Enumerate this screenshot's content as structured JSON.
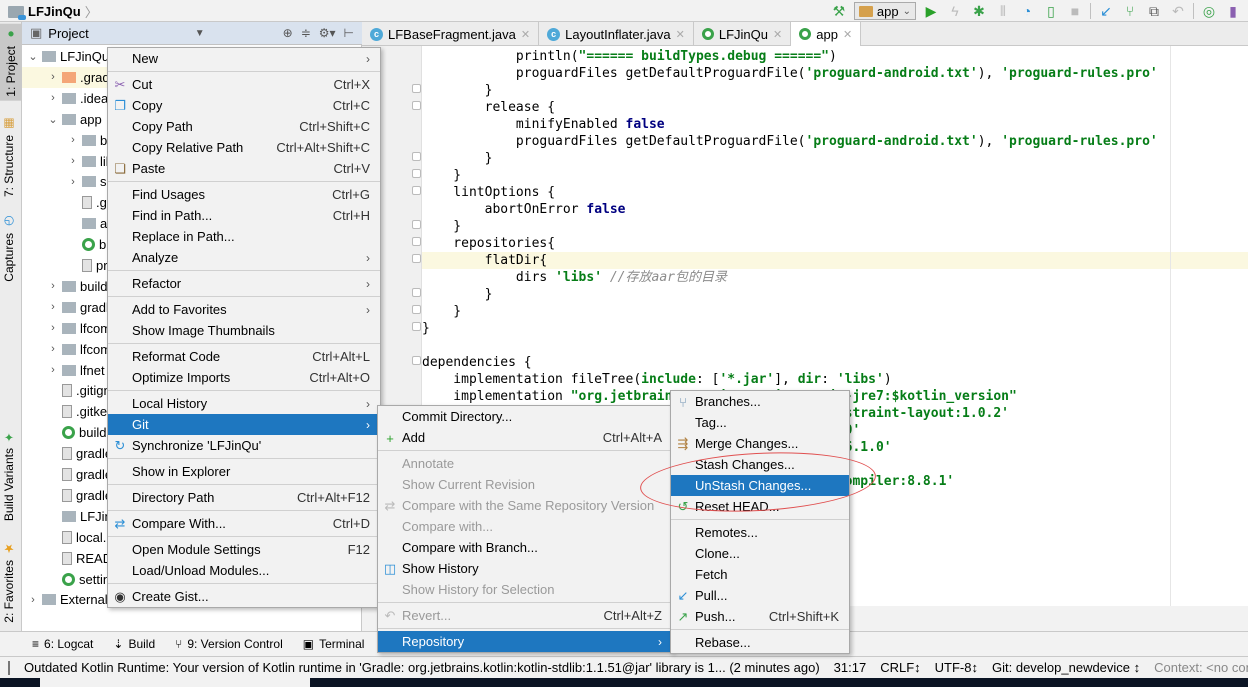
{
  "navbar": {
    "project_name": "LFJinQu",
    "run_config": "app"
  },
  "left_strip": {
    "tabs": [
      {
        "label": "1: Project",
        "active": true
      },
      {
        "label": "7: Structure"
      },
      {
        "label": "Captures"
      },
      {
        "label": "Build Variants"
      },
      {
        "label": "2: Favorites"
      }
    ]
  },
  "project_panel": {
    "title": "Project",
    "tree": [
      {
        "label": "LFJinQu",
        "indent": 0,
        "expanded": true,
        "icon": "module-folder"
      },
      {
        "label": ".gradle",
        "indent": 1,
        "collapsed": true,
        "icon": "orange-folder",
        "highlight": true
      },
      {
        "label": ".idea",
        "indent": 1,
        "collapsed": true,
        "icon": "folder"
      },
      {
        "label": "app",
        "indent": 1,
        "expanded": true,
        "icon": "module-folder"
      },
      {
        "label": "build",
        "indent": 2,
        "collapsed": true,
        "icon": "folder"
      },
      {
        "label": "libs",
        "indent": 2,
        "collapsed": true,
        "icon": "folder"
      },
      {
        "label": "src",
        "indent": 2,
        "collapsed": true,
        "icon": "folder"
      },
      {
        "label": ".gitignore",
        "indent": 2,
        "icon": "file"
      },
      {
        "label": "app.iml",
        "indent": 2,
        "icon": "module-file"
      },
      {
        "label": "build.gradle",
        "indent": 2,
        "icon": "gradle"
      },
      {
        "label": "proguard-rules.pro",
        "indent": 2,
        "icon": "file"
      },
      {
        "label": "build",
        "indent": 1,
        "collapsed": true,
        "icon": "folder"
      },
      {
        "label": "gradle",
        "indent": 1,
        "collapsed": true,
        "icon": "folder"
      },
      {
        "label": "lfcommon",
        "indent": 1,
        "collapsed": true,
        "icon": "lib-folder"
      },
      {
        "label": "lfcomponent",
        "indent": 1,
        "collapsed": true,
        "icon": "lib-folder"
      },
      {
        "label": "lfnet",
        "indent": 1,
        "collapsed": true,
        "icon": "lib-folder"
      },
      {
        "label": ".gitignore",
        "indent": 1,
        "icon": "file"
      },
      {
        "label": ".gitkeep",
        "indent": 1,
        "icon": "unknown-file"
      },
      {
        "label": "build.gradle",
        "indent": 1,
        "icon": "gradle"
      },
      {
        "label": "gradle.properties",
        "indent": 1,
        "icon": "props-file"
      },
      {
        "label": "gradlew",
        "indent": 1,
        "icon": "file"
      },
      {
        "label": "gradlew.bat",
        "indent": 1,
        "icon": "file"
      },
      {
        "label": "LFJinQu.iml",
        "indent": 1,
        "icon": "module-file"
      },
      {
        "label": "local.properties",
        "indent": 1,
        "icon": "props-file"
      },
      {
        "label": "README.md",
        "indent": 1,
        "icon": "unknown-file"
      },
      {
        "label": "settings.gradle",
        "indent": 1,
        "icon": "gradle"
      },
      {
        "label": "External Libraries",
        "indent": 0,
        "collapsed": true,
        "icon": "libraries"
      }
    ]
  },
  "editor_tabs": [
    {
      "label": "LFBaseFragment.java",
      "icon": "class"
    },
    {
      "label": "LayoutInflater.java",
      "icon": "class"
    },
    {
      "label": "LFJinQu",
      "icon": "gradle"
    },
    {
      "label": "app",
      "icon": "gradle",
      "active": true
    }
  ],
  "editor": {
    "lines": [
      [
        {
          "t": "            println("
        },
        {
          "t": "\"====== buildTypes.debug ======\"",
          "c": "str"
        },
        {
          "t": ")"
        }
      ],
      [
        {
          "t": "            proguardFiles getDefaultProguardFile("
        },
        {
          "t": "'proguard-android.txt'",
          "c": "str"
        },
        {
          "t": "), "
        },
        {
          "t": "'proguard-rules.pro'",
          "c": "str"
        }
      ],
      [
        {
          "t": "        }"
        }
      ],
      [
        {
          "t": "        release {"
        }
      ],
      [
        {
          "t": "            minifyEnabled "
        },
        {
          "t": "false",
          "c": "kw"
        }
      ],
      [
        {
          "t": "            proguardFiles getDefaultProguardFile("
        },
        {
          "t": "'proguard-android.txt'",
          "c": "str"
        },
        {
          "t": "), "
        },
        {
          "t": "'proguard-rules.pro'",
          "c": "str"
        }
      ],
      [
        {
          "t": "        }"
        }
      ],
      [
        {
          "t": "    }"
        }
      ],
      [
        {
          "t": "    lintOptions {"
        }
      ],
      [
        {
          "t": "        abortOnError "
        },
        {
          "t": "false",
          "c": "kw"
        }
      ],
      [
        {
          "t": "    }"
        }
      ],
      [
        {
          "t": "    repositories{"
        }
      ],
      [
        {
          "t": "        flatDir{"
        }
      ],
      [
        {
          "t": "            dirs "
        },
        {
          "t": "'libs'",
          "c": "str"
        },
        {
          "t": " //存放aar包的目录",
          "c": "cmt"
        }
      ],
      [
        {
          "t": "        }"
        }
      ],
      [
        {
          "t": "    }"
        }
      ],
      [
        {
          "t": "}"
        }
      ],
      [
        {
          "t": ""
        }
      ],
      [
        {
          "t": "dependencies {"
        }
      ],
      [
        {
          "t": "    implementation fileTree("
        },
        {
          "t": "include",
          "c": "str"
        },
        {
          "t": ": ["
        },
        {
          "t": "'*.jar'",
          "c": "str"
        },
        {
          "t": "], "
        },
        {
          "t": "dir",
          "c": "str"
        },
        {
          "t": ": "
        },
        {
          "t": "'libs'",
          "c": "str"
        },
        {
          "t": ")"
        }
      ],
      [
        {
          "t": "    implementation "
        },
        {
          "t": "\"org.jetbrains.kotlin:kotlin-stdlib-jre7:$kotlin_version\"",
          "c": "str"
        }
      ],
      [
        {
          "t": "    implementation "
        },
        {
          "t": "'com.android.support.constraint:constraint-layout:1.0.2'",
          "c": "str"
        }
      ],
      [
        {
          "t": "    implementation "
        },
        {
          "t": "'com.jakewharton:butterknife:8.8.1.0'",
          "c": "str"
        }
      ],
      [
        {
          "t": "    implementation "
        },
        {
          "t": "'com.android.support:appcompat-v7:26.1.0'",
          "c": "str"
        }
      ],
      [
        {
          "t": ""
        }
      ],
      [
        {
          "t": "    annotationProcessor "
        },
        {
          "t": "'com.jakewharton:butterknife-compiler:8.8.1'",
          "c": "str"
        }
      ]
    ],
    "highlight_line": 12,
    "visible_tail_fragments": [
      " .1.0'",
      " .0'"
    ]
  },
  "context_menu": {
    "items": [
      {
        "label": "New",
        "submenu": true
      },
      {
        "sep": true
      },
      {
        "label": "Cut",
        "shortcut": "Ctrl+X",
        "icon": "scissors-icon"
      },
      {
        "label": "Copy",
        "shortcut": "Ctrl+C",
        "icon": "copy-icon"
      },
      {
        "label": "Copy Path",
        "shortcut": "Ctrl+Shift+C"
      },
      {
        "label": "Copy Relative Path",
        "shortcut": "Ctrl+Alt+Shift+C"
      },
      {
        "label": "Paste",
        "shortcut": "Ctrl+V",
        "icon": "paste-icon"
      },
      {
        "sep": true
      },
      {
        "label": "Find Usages",
        "shortcut": "Ctrl+G"
      },
      {
        "label": "Find in Path...",
        "shortcut": "Ctrl+H"
      },
      {
        "label": "Replace in Path..."
      },
      {
        "label": "Analyze",
        "submenu": true
      },
      {
        "sep": true
      },
      {
        "label": "Refactor",
        "submenu": true
      },
      {
        "sep": true
      },
      {
        "label": "Add to Favorites",
        "submenu": true
      },
      {
        "label": "Show Image Thumbnails"
      },
      {
        "sep": true
      },
      {
        "label": "Reformat Code",
        "shortcut": "Ctrl+Alt+L"
      },
      {
        "label": "Optimize Imports",
        "shortcut": "Ctrl+Alt+O"
      },
      {
        "sep": true
      },
      {
        "label": "Local History",
        "submenu": true
      },
      {
        "label": "Git",
        "submenu": true,
        "selected": true
      },
      {
        "label": "Synchronize 'LFJinQu'",
        "icon": "sync-icon"
      },
      {
        "sep": true
      },
      {
        "label": "Show in Explorer"
      },
      {
        "sep": true
      },
      {
        "label": "Directory Path",
        "shortcut": "Ctrl+Alt+F12"
      },
      {
        "sep": true
      },
      {
        "label": "Compare With...",
        "shortcut": "Ctrl+D",
        "icon": "compare-icon"
      },
      {
        "sep": true
      },
      {
        "label": "Open Module Settings",
        "shortcut": "F12"
      },
      {
        "label": "Load/Unload Modules..."
      },
      {
        "sep": true
      },
      {
        "label": "Create Gist...",
        "icon": "github-icon"
      }
    ]
  },
  "git_menu": {
    "items": [
      {
        "label": "Commit Directory..."
      },
      {
        "label": "Add",
        "shortcut": "Ctrl+Alt+A",
        "icon": "plus-icon"
      },
      {
        "sep": true
      },
      {
        "label": "Annotate",
        "disabled": true
      },
      {
        "label": "Show Current Revision",
        "disabled": true
      },
      {
        "label": "Compare with the Same Repository Version",
        "disabled": true,
        "icon": "compare-icon"
      },
      {
        "label": "Compare with...",
        "disabled": true
      },
      {
        "label": "Compare with Branch..."
      },
      {
        "label": "Show History",
        "icon": "history-icon"
      },
      {
        "label": "Show History for Selection",
        "disabled": true
      },
      {
        "sep": true
      },
      {
        "label": "Revert...",
        "shortcut": "Ctrl+Alt+Z",
        "disabled": true,
        "icon": "revert-icon"
      },
      {
        "sep": true
      },
      {
        "label": "Repository",
        "submenu": true,
        "selected": true
      }
    ]
  },
  "repository_menu": {
    "items": [
      {
        "label": "Branches...",
        "icon": "branch-icon"
      },
      {
        "label": "Tag..."
      },
      {
        "label": "Merge Changes...",
        "icon": "merge-icon"
      },
      {
        "label": "Stash Changes..."
      },
      {
        "label": "UnStash Changes...",
        "selected": true
      },
      {
        "label": "Reset HEAD...",
        "icon": "reset-icon"
      },
      {
        "sep": true
      },
      {
        "label": "Remotes..."
      },
      {
        "label": "Clone..."
      },
      {
        "label": "Fetch"
      },
      {
        "label": "Pull...",
        "icon": "pull-icon"
      },
      {
        "label": "Push...",
        "shortcut": "Ctrl+Shift+K",
        "icon": "push-icon"
      },
      {
        "sep": true
      },
      {
        "label": "Rebase..."
      }
    ]
  },
  "bottom_tools": [
    {
      "label": "6: Logcat",
      "icon": "logcat-icon"
    },
    {
      "label": "Build",
      "icon": "build-icon"
    },
    {
      "label": "9: Version Control",
      "icon": "vcs-icon"
    },
    {
      "label": "Terminal",
      "icon": "terminal-icon"
    }
  ],
  "status_bar": {
    "message": "Outdated Kotlin Runtime: Your version of Kotlin runtime in 'Gradle: org.jetbrains.kotlin:kotlin-stdlib:1.1.51@jar' library is 1... (2 minutes ago)",
    "position": "31:17",
    "line_sep": "CRLF↕",
    "encoding": "UTF-8↕",
    "git_branch": "Git: develop_newdevice ↕",
    "context": "Context: <no context>"
  },
  "colors": {
    "selection": "#1e77c0",
    "string": "#067d17",
    "keyword": "#000080",
    "annotation": "#e05050"
  }
}
